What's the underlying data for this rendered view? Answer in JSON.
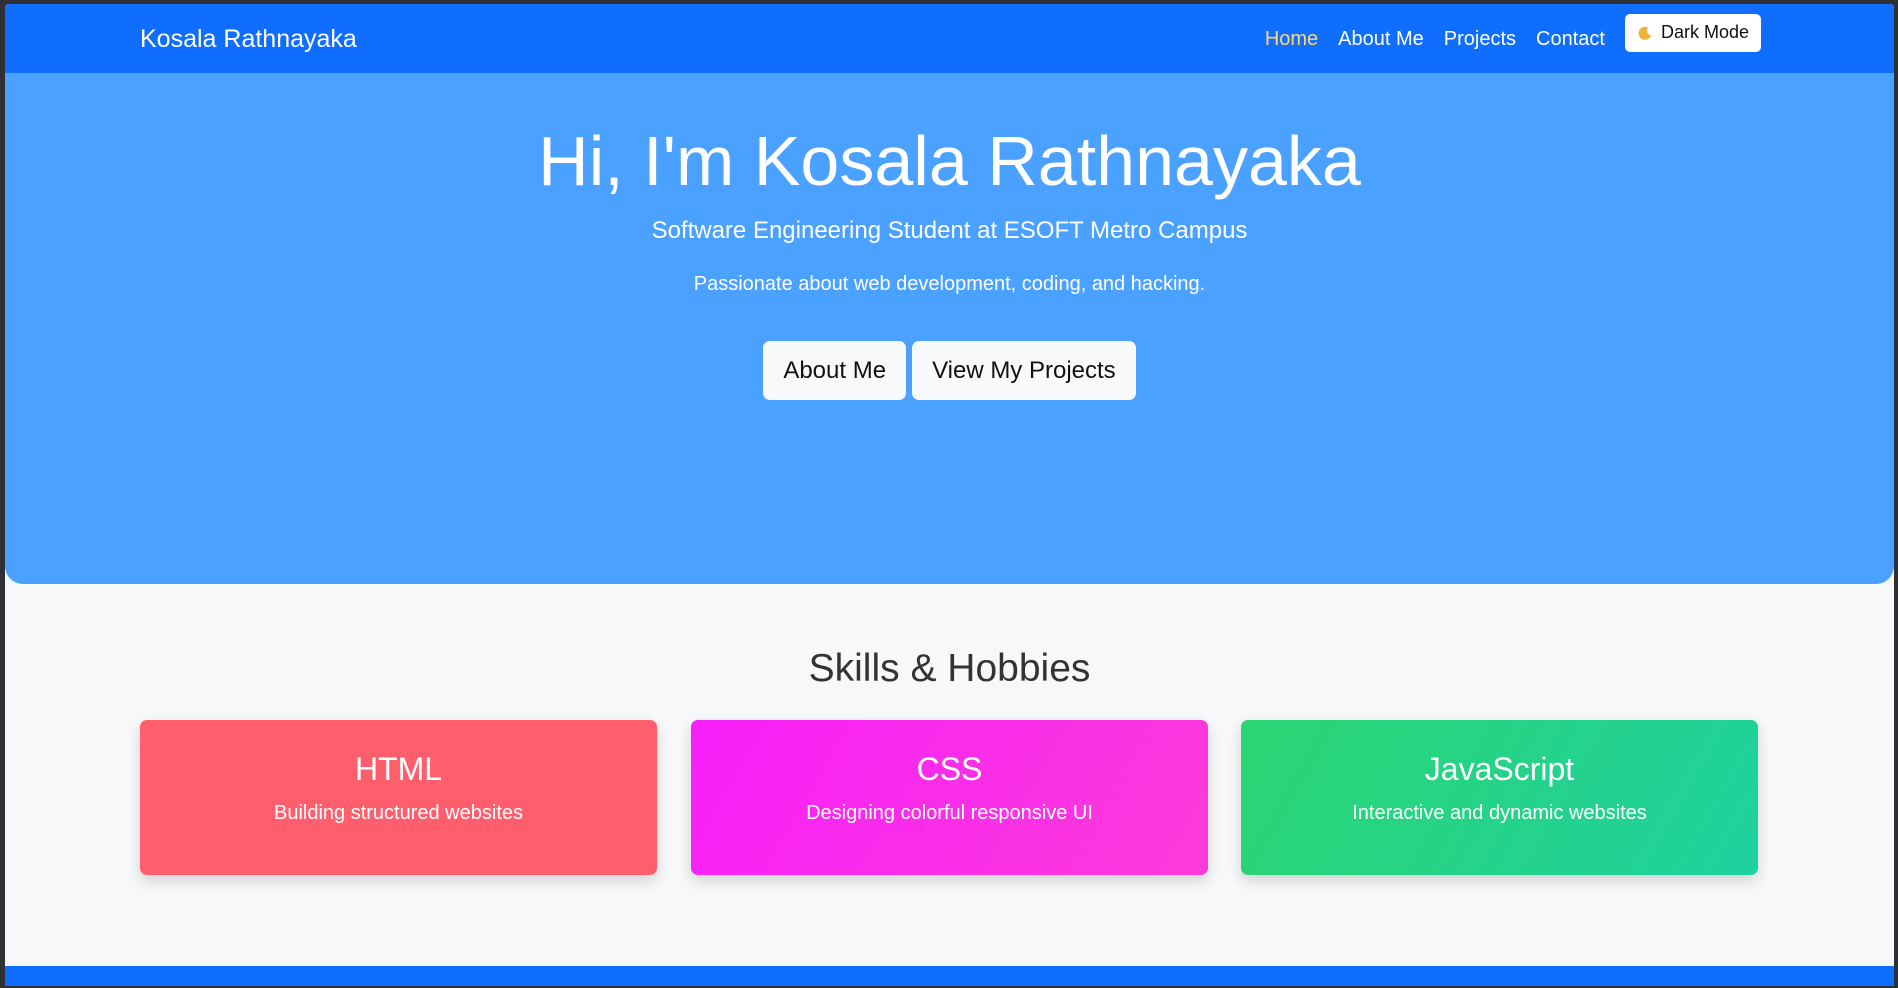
{
  "navbar": {
    "brand": "Kosala Rathnayaka",
    "links": [
      {
        "label": "Home",
        "active": true
      },
      {
        "label": "About Me",
        "active": false
      },
      {
        "label": "Projects",
        "active": false
      },
      {
        "label": "Contact",
        "active": false
      }
    ],
    "dark_mode_label": "Dark Mode",
    "dark_mode_icon": "moon-icon",
    "color": "#0f6efd",
    "active_link_color": "#ffd770"
  },
  "hero": {
    "title": "Hi, I'm Kosala Rathnayaka",
    "subtitle": "Software Engineering Student at ESOFT Metro Campus",
    "tagline": "Passionate about web development, coding, and hacking.",
    "buttons": [
      {
        "label": "About Me"
      },
      {
        "label": "View My Projects"
      }
    ],
    "color": "#4aa1ff"
  },
  "skills": {
    "title": "Skills & Hobbies",
    "cards": [
      {
        "title": "HTML",
        "description": "Building structured websites",
        "colors": [
          "#ff5f6d",
          "#ff5f6d"
        ]
      },
      {
        "title": "CSS",
        "description": "Designing colorful responsive UI",
        "colors": [
          "#f81ffa",
          "#fc3bd8"
        ]
      },
      {
        "title": "JavaScript",
        "description": "Interactive and dynamic websites",
        "colors": [
          "#2bd572",
          "#1fd19f"
        ]
      }
    ]
  },
  "footer": {
    "color": "#0f6efd"
  }
}
